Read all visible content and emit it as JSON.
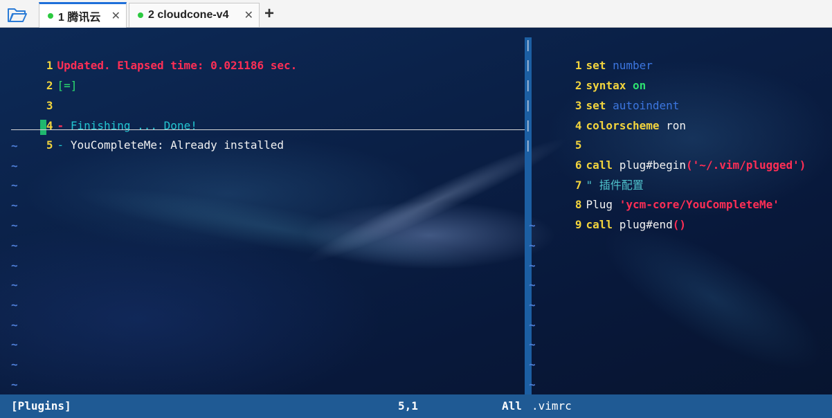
{
  "tabs": [
    {
      "label": "1 腾讯云",
      "close": "✕"
    },
    {
      "label": "2 cloudcone-v4",
      "close": "✕"
    }
  ],
  "new_tab_label": "+",
  "left_pane": {
    "line1": {
      "num": "1",
      "text": "Updated. Elapsed time: 0.021186 sec."
    },
    "line2": {
      "num": "2",
      "text": "[=]"
    },
    "line3": {
      "num": "3"
    },
    "line4": {
      "num": "4",
      "dash": "-",
      "text": "Finishing ... Done!"
    },
    "line5": {
      "num": "5",
      "dash": "-",
      "text": "YouCompleteMe: Already installed"
    },
    "tilde": "~"
  },
  "right_pane": {
    "line1": {
      "num": "1",
      "kw": "set",
      "arg": "number"
    },
    "line2": {
      "num": "2",
      "kw": "syntax",
      "arg": "on"
    },
    "line3": {
      "num": "3",
      "kw": "set",
      "arg": "autoindent"
    },
    "line4": {
      "num": "4",
      "kw": "colorscheme",
      "arg": "ron"
    },
    "line5": {
      "num": "5"
    },
    "line6": {
      "num": "6",
      "kw": "call",
      "fn": "plug#begin",
      "open": "(",
      "str": "'~/.vim/plugged'",
      "close": ")"
    },
    "line7": {
      "num": "7",
      "text": "\" 插件配置"
    },
    "line8": {
      "num": "8",
      "kw": "Plug",
      "str": "'ycm-core/YouCompleteMe'"
    },
    "line9": {
      "num": "9",
      "kw": "call",
      "fn": "plug#end",
      "open": "(",
      "close": ")"
    },
    "tilde": "~"
  },
  "separator": "|",
  "status": {
    "left": "[Plugins]",
    "position": "5,1",
    "scroll": "All",
    "right": ".vimrc"
  },
  "colors": {
    "accent_tab": "#1e6fd9",
    "status_bg": "#1f5a94",
    "line_number": "#f2d43d",
    "error_red": "#ff2e55"
  }
}
